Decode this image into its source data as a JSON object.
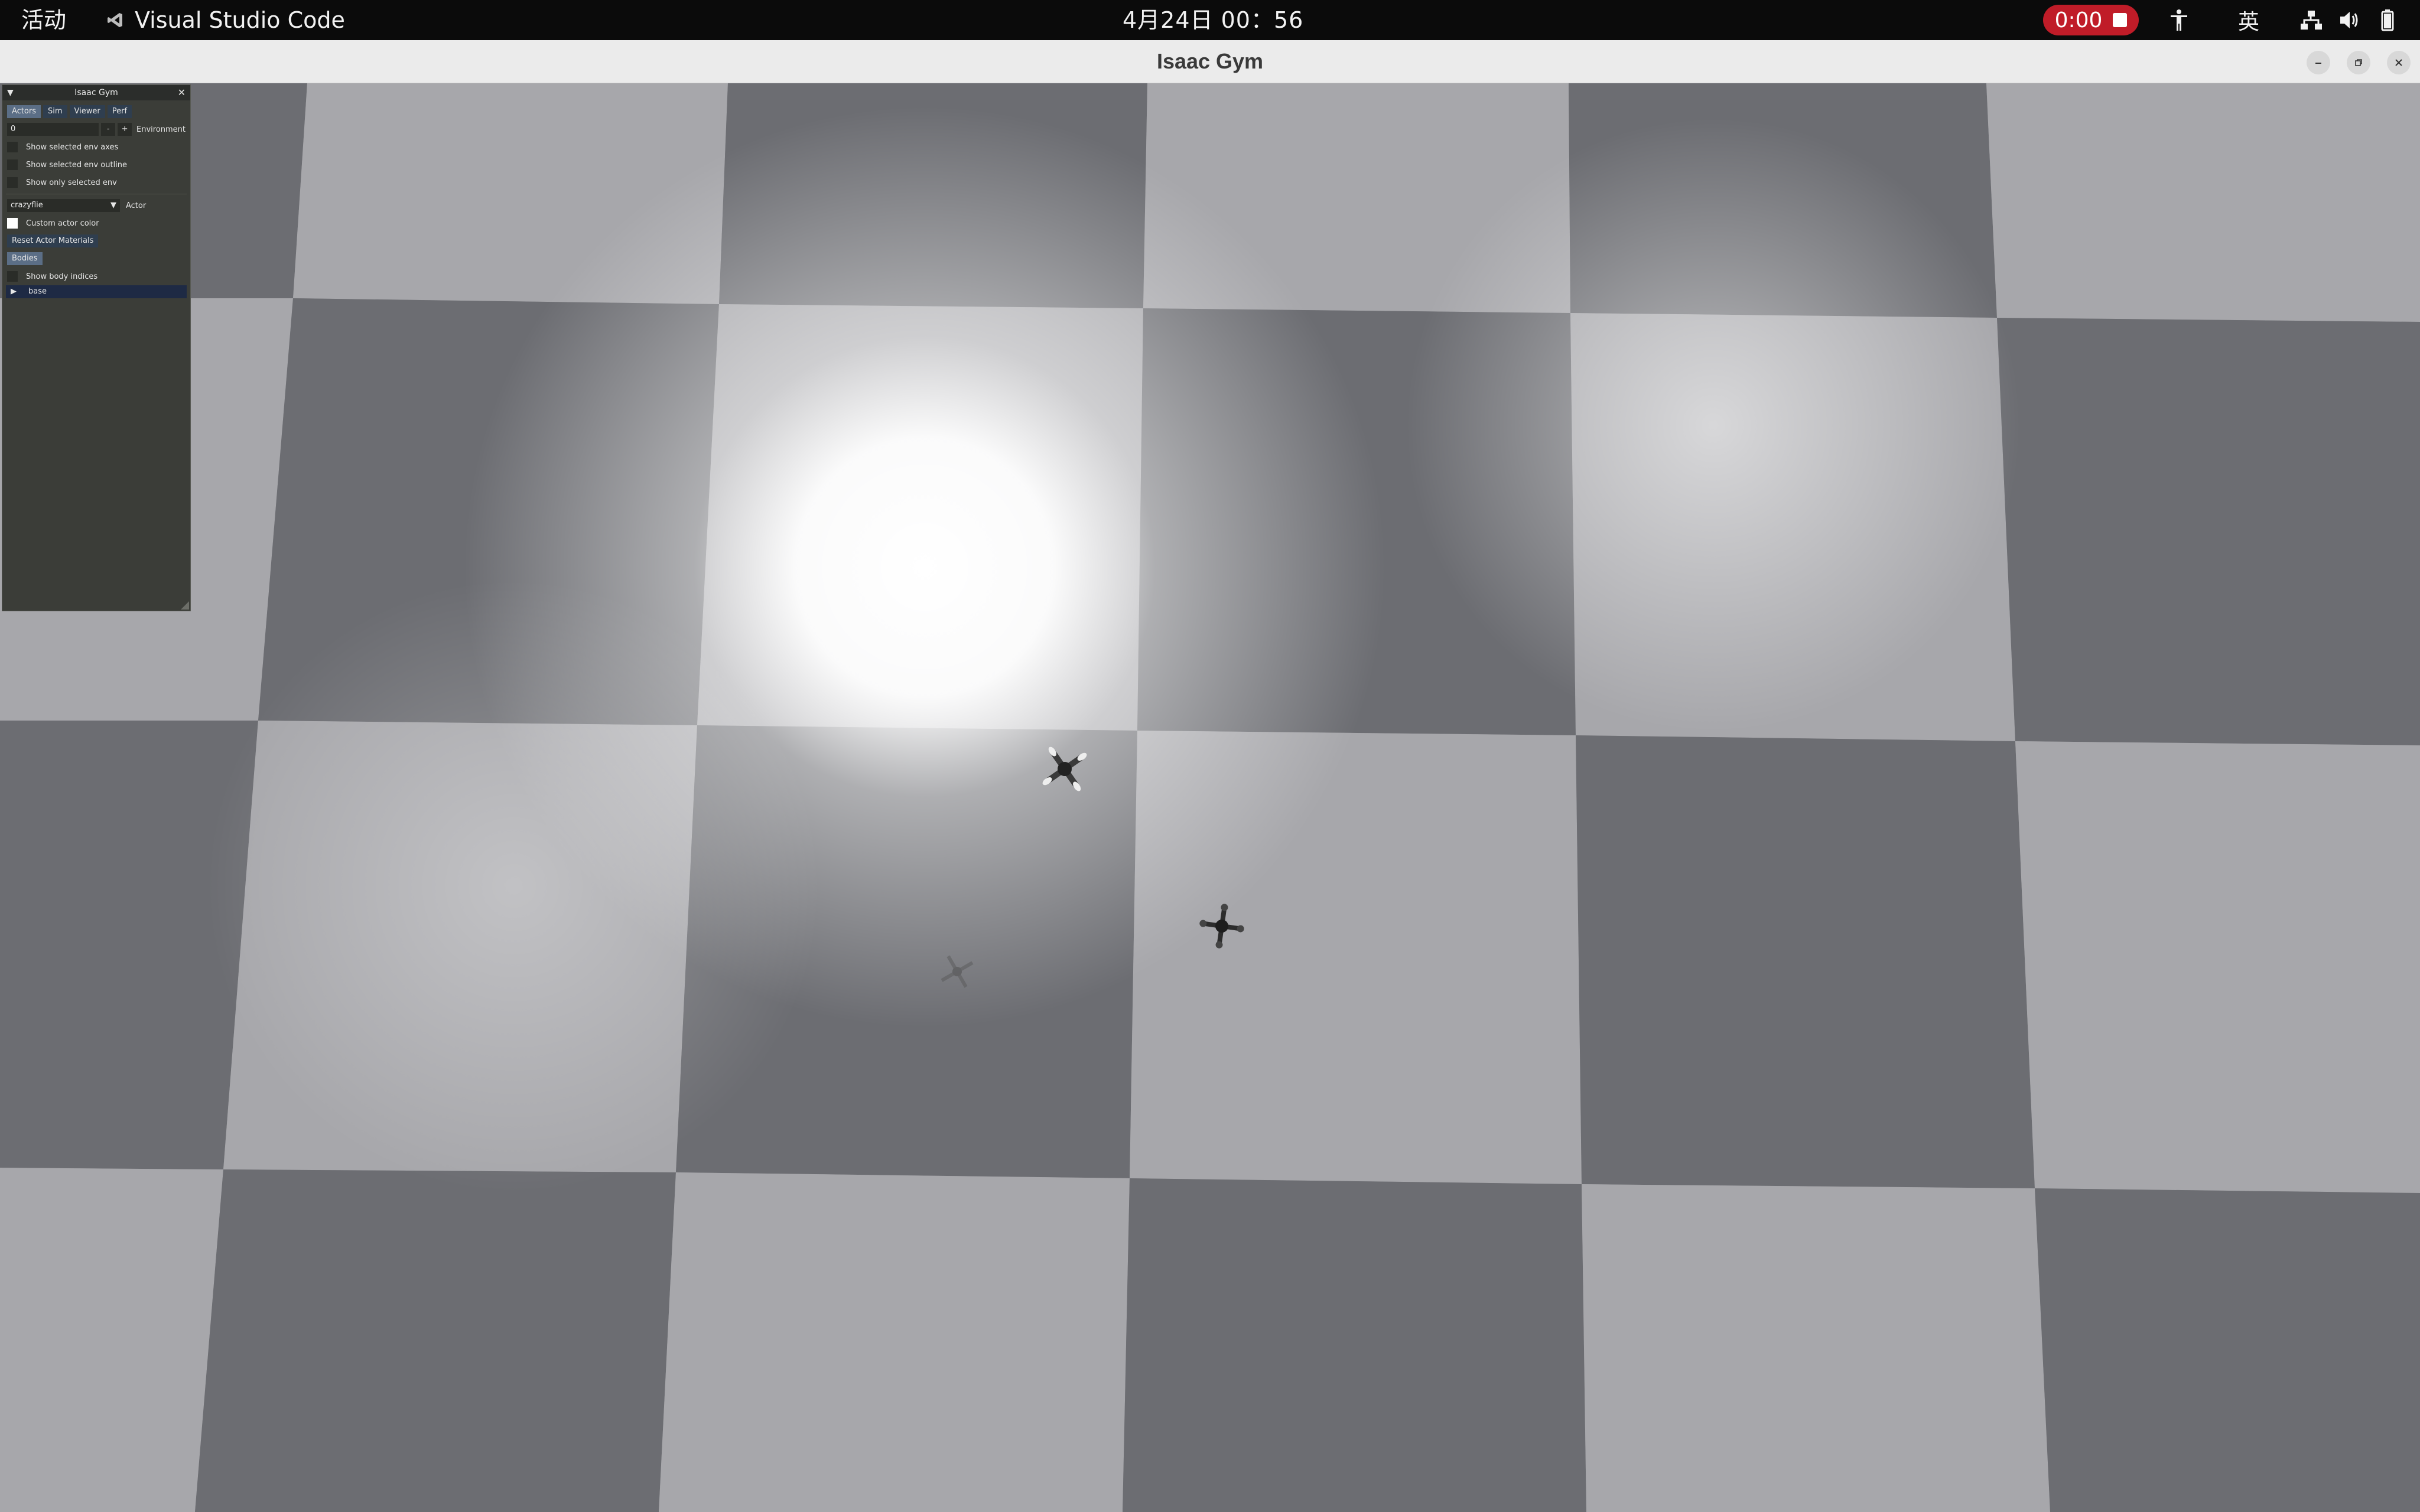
{
  "topbar": {
    "activities": "活动",
    "app_name": "Visual Studio Code",
    "datetime": "4月24日 00：56",
    "recording_time": "0:00",
    "input_method": "英"
  },
  "window": {
    "title": "Isaac Gym"
  },
  "gui_panel": {
    "title": "Isaac Gym",
    "tabs": [
      "Actors",
      "Sim",
      "Viewer",
      "Perf"
    ],
    "active_tab": "Actors",
    "environment": {
      "value": "0",
      "minus": "-",
      "plus": "+",
      "label": "Environment"
    },
    "env_options": [
      {
        "label": "Show selected env axes",
        "checked": false
      },
      {
        "label": "Show selected env outline",
        "checked": false
      },
      {
        "label": "Show only selected env",
        "checked": false
      }
    ],
    "actor": {
      "value": "crazyflie",
      "label": "Actor"
    },
    "custom_actor_color": {
      "label": "Custom actor color",
      "checked": true
    },
    "reset_button": "Reset Actor Materials",
    "bodies_header": "Bodies",
    "show_body_indices": {
      "label": "Show body indices",
      "checked": false
    },
    "tree_items": [
      "base"
    ]
  },
  "colors": {
    "topbar_bg": "#0b0b0b",
    "record_red": "#c01c28",
    "titlebar_bg": "#ebebeb",
    "tile_light": "#a7a7ab",
    "tile_dark": "#6c6d72",
    "panel_bg": "#3b3d38",
    "tab_bg": "#2f3e4f"
  }
}
